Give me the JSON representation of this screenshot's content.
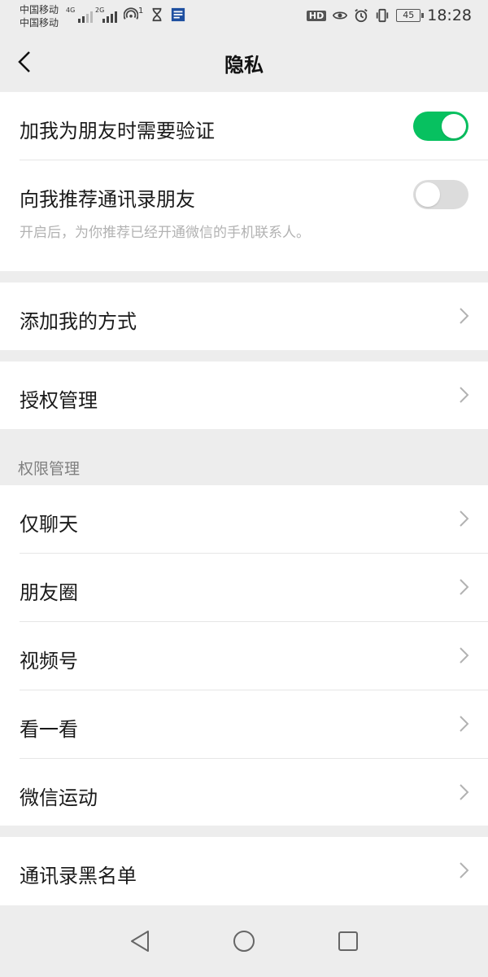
{
  "status_bar": {
    "carrier_1": "中国移动",
    "carrier_2": "中国移动",
    "net_1": "4G",
    "net_2": "2G",
    "hotspot_count": "1",
    "hd": "HD",
    "battery": "45",
    "time": "18:28"
  },
  "nav": {
    "title": "隐私"
  },
  "privacy": {
    "verify_label": "加我为朋友时需要验证",
    "verify_on": true,
    "recommend_label": "向我推荐通讯录朋友",
    "recommend_on": false,
    "recommend_desc": "开启后，为你推荐已经开通微信的手机联系人。"
  },
  "add_methods": {
    "label": "添加我的方式"
  },
  "authorization": {
    "label": "授权管理"
  },
  "permissions": {
    "section_title": "权限管理",
    "items": [
      {
        "label": "仅聊天"
      },
      {
        "label": "朋友圈"
      },
      {
        "label": "视频号"
      },
      {
        "label": "看一看"
      },
      {
        "label": "微信运动"
      }
    ]
  },
  "blacklist": {
    "label": "通讯录黑名单"
  },
  "colors": {
    "accent": "#07c160",
    "background": "#ededed",
    "row": "#ffffff"
  }
}
